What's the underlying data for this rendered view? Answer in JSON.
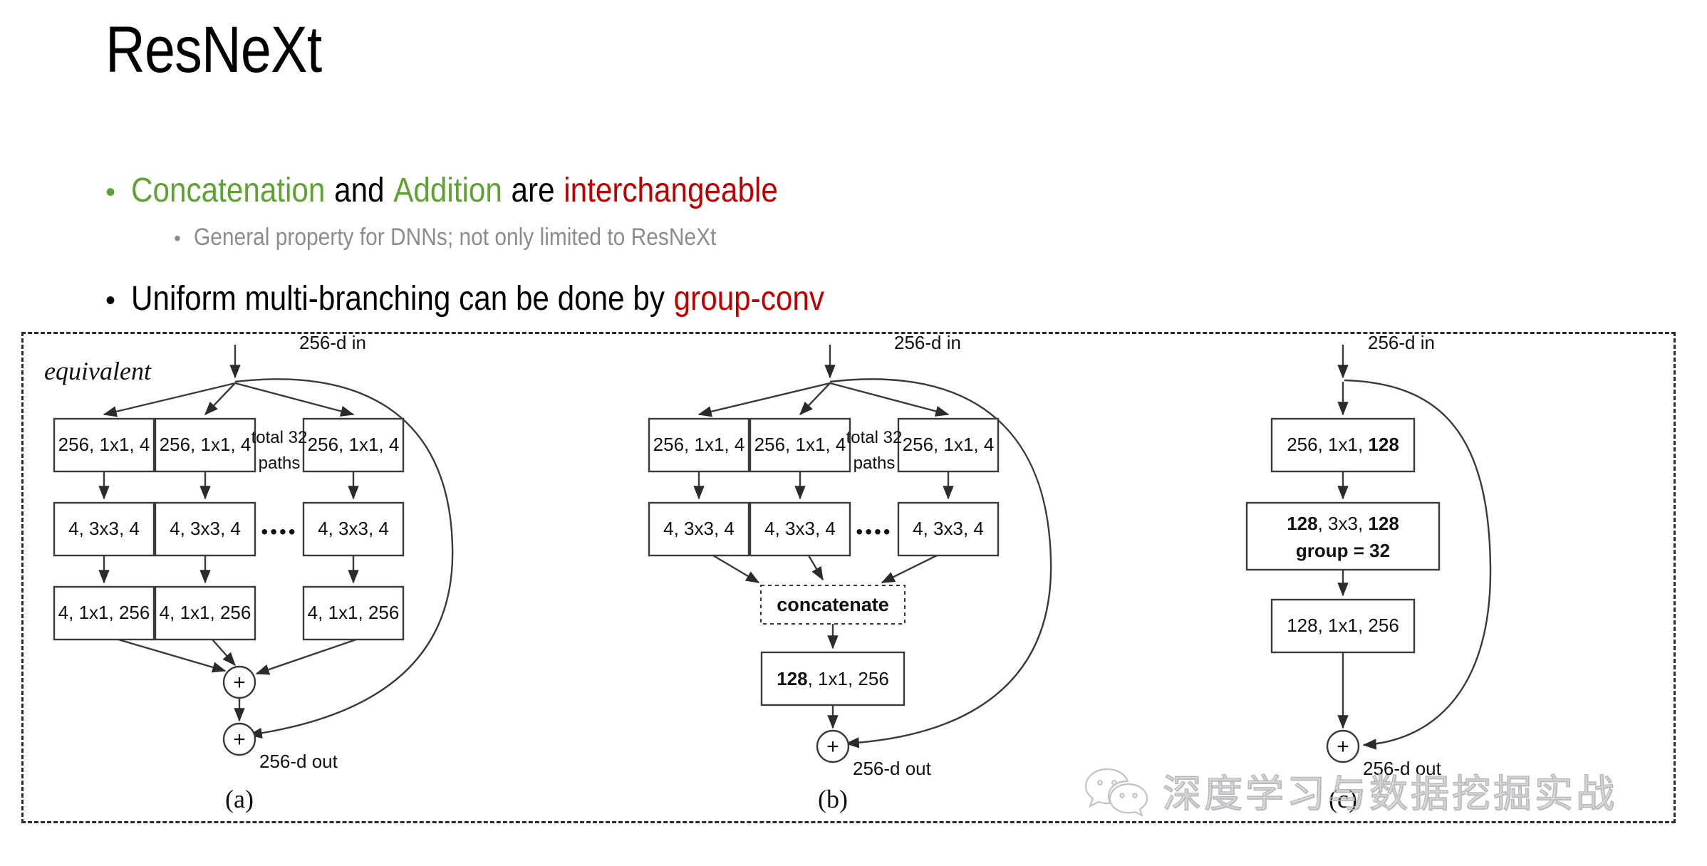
{
  "slide": {
    "title": "ResNeXt"
  },
  "bullets": [
    {
      "level": 1,
      "marker": "•",
      "segments": [
        {
          "text": "Concatenation",
          "color": "#5ea233"
        },
        {
          "text": "and",
          "color": "#000000"
        },
        {
          "text": "Addition",
          "color": "#5ea233"
        },
        {
          "text": "are",
          "color": "#000000"
        },
        {
          "text": "interchangeable",
          "color": "#c00000"
        }
      ]
    },
    {
      "level": 2,
      "marker": "•",
      "segments": [
        {
          "text": "General property for DNNs; not only limited to ResNeXt",
          "color": "#8c8c8c"
        }
      ]
    },
    {
      "level": 1,
      "marker": "•",
      "segments": [
        {
          "text": "Uniform multi-branching can be done by",
          "color": "#000000"
        },
        {
          "text": "group-conv",
          "color": "#c00000"
        }
      ]
    }
  ],
  "figure": {
    "frame_label": "equivalent",
    "panels": [
      {
        "id": "a",
        "caption": "(a)",
        "input_label": "256-d in",
        "output_label": "256-d out",
        "paths_note_line1": "total 32",
        "paths_note_line2": "paths",
        "ellipsis": "••••",
        "columns": [
          {
            "boxes": [
              "256, 1x1, 4",
              "4, 3x3, 4",
              "4, 1x1, 256"
            ]
          },
          {
            "boxes": [
              "256, 1x1, 4",
              "4, 3x3, 4",
              "4, 1x1, 256"
            ]
          },
          {
            "boxes": [
              "256, 1x1, 4",
              "4, 3x3, 4",
              "4, 1x1, 256"
            ]
          }
        ],
        "adders": [
          "+",
          "+"
        ]
      },
      {
        "id": "b",
        "caption": "(b)",
        "input_label": "256-d in",
        "output_label": "256-d out",
        "paths_note_line1": "total 32",
        "paths_note_line2": "paths",
        "ellipsis": "••••",
        "columns": [
          {
            "boxes": [
              "256, 1x1, 4",
              "4, 3x3, 4"
            ]
          },
          {
            "boxes": [
              "256, 1x1, 4",
              "4, 3x3, 4"
            ]
          },
          {
            "boxes": [
              "256, 1x1, 4",
              "4, 3x3, 4"
            ]
          }
        ],
        "concat_label": "concatenate",
        "merge_box": {
          "bold_prefix": "128",
          "rest": ", 1x1, 256"
        },
        "adders": [
          "+"
        ]
      },
      {
        "id": "c",
        "caption": "(c)",
        "input_label": "256-d in",
        "output_label": "256-d out",
        "boxes": [
          {
            "plain_prefix": "256, 1x1, ",
            "bold_suffix": "128"
          },
          {
            "line1_bold_a": "128",
            "line1_plain": ", 3x3, ",
            "line1_bold_b": "128",
            "line2": "group = 32"
          },
          {
            "plain": "128, 1x1, 256"
          }
        ],
        "adders": [
          "+"
        ]
      }
    ]
  },
  "watermark": {
    "icon": "wechat-icon",
    "text": "深度学习与数据挖掘实战"
  },
  "colors": {
    "green": "#5ea233",
    "red": "#c00000",
    "gray": "#8c8c8c",
    "black": "#000000",
    "stroke": "#3a3a3a"
  }
}
